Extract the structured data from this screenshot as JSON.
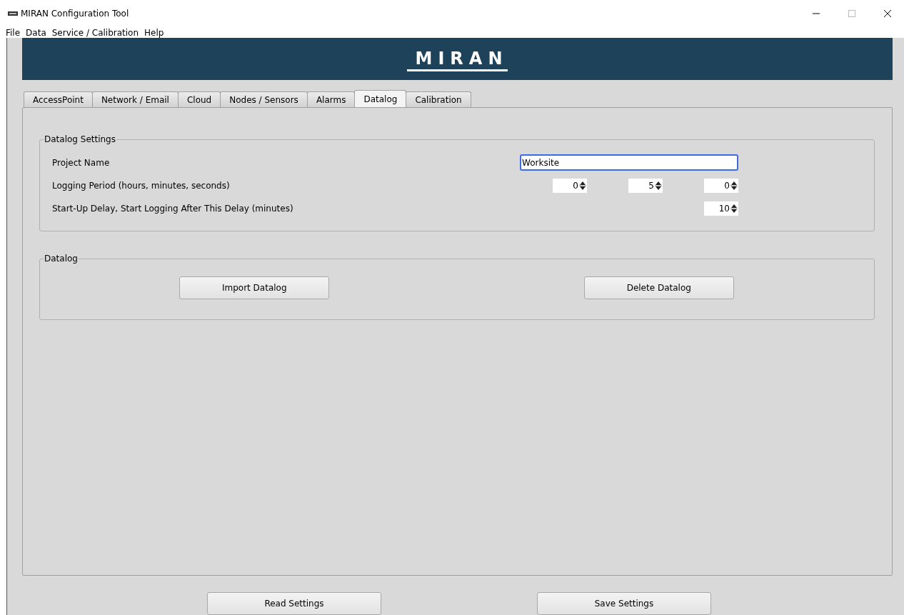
{
  "window": {
    "title": "MIRAN Configuration Tool"
  },
  "menu": [
    "File",
    "Data",
    "Service / Calibration",
    "Help"
  ],
  "banner": {
    "logo": "MIRAN"
  },
  "tabs": [
    {
      "label": "AccessPoint",
      "selected": false
    },
    {
      "label": "Network / Email",
      "selected": false
    },
    {
      "label": "Cloud",
      "selected": false
    },
    {
      "label": "Nodes / Sensors",
      "selected": false
    },
    {
      "label": "Alarms",
      "selected": false
    },
    {
      "label": "Datalog",
      "selected": true
    },
    {
      "label": "Calibration",
      "selected": false
    }
  ],
  "settings_group": {
    "title": "Datalog Settings",
    "rows": [
      {
        "kind": "text",
        "label": "Project Name",
        "value": "Worksite",
        "focused": true
      },
      {
        "kind": "spinners",
        "label": "Logging Period (hours, minutes, seconds)",
        "values": [
          "0",
          "5",
          "0"
        ]
      },
      {
        "kind": "spinners",
        "label": "Start-Up Delay, Start Logging After This Delay (minutes)",
        "values": [
          "10"
        ]
      }
    ]
  },
  "datalog_group": {
    "title": "Datalog",
    "buttons": [
      "Import Datalog",
      "Delete Datalog"
    ]
  },
  "footer_buttons": [
    "Read Settings",
    "Save Settings"
  ]
}
